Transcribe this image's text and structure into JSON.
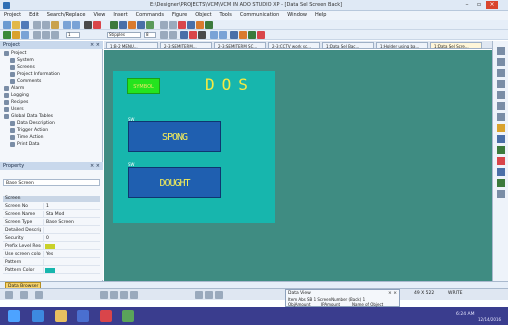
{
  "window": {
    "title": "E:\\Designer\\PROJECTS\\VCM\\VCM IN ADO STUDIO XP - [Data Sel Screen Back]",
    "minimize": "–",
    "restore": "▫",
    "close": "×"
  },
  "menu": {
    "items": [
      "Project",
      "Edit",
      "Search/Replace",
      "View",
      "Insert",
      "Commands",
      "Figure",
      "Object",
      "Tools",
      "Communication",
      "Window",
      "Help"
    ]
  },
  "toolbar": {
    "zoom_value": "1",
    "font_value": "Stipples",
    "size_value": "8"
  },
  "project_panel": {
    "title": "Project",
    "close": "× ×",
    "tree": [
      {
        "label": "Project",
        "indent": 0
      },
      {
        "label": "System",
        "indent": 1
      },
      {
        "label": "Screens",
        "indent": 1
      },
      {
        "label": "Project Information",
        "indent": 1
      },
      {
        "label": "Comments",
        "indent": 1
      },
      {
        "label": "Alarm",
        "indent": 0
      },
      {
        "label": "Logging",
        "indent": 0
      },
      {
        "label": "Recipes",
        "indent": 0
      },
      {
        "label": "Users",
        "indent": 0
      },
      {
        "label": "Global Data Tables",
        "indent": 0
      },
      {
        "label": "Data Description",
        "indent": 1
      },
      {
        "label": "Trigger Action",
        "indent": 1
      },
      {
        "label": "Time Action",
        "indent": 1
      },
      {
        "label": "Print Data",
        "indent": 1
      }
    ],
    "tabs": [
      "Project",
      "System",
      "Screen"
    ]
  },
  "property_panel": {
    "title": "Property",
    "close": "× ×",
    "selected_object": "Base Screen",
    "category": "Screen",
    "rows": [
      {
        "key": "Screen No",
        "value": "1"
      },
      {
        "key": "Screen Name",
        "value": "Sta Mod"
      },
      {
        "key": "Screen Type",
        "value": "Base Screen"
      },
      {
        "key": "Detailed Description",
        "value": ""
      },
      {
        "key": "Security",
        "value": "0"
      },
      {
        "key": "Prefix Level Resource",
        "value": ""
      },
      {
        "key": "Use screen color",
        "value": "Yes"
      },
      {
        "key": "Pattern",
        "value": ""
      },
      {
        "key": "Pattern Color",
        "value": ""
      }
    ],
    "prefix_color": "#c9d12a",
    "pattern_color": "#17b6ad"
  },
  "document_tabs": [
    {
      "label": "1:B-2 MENU...",
      "active": false
    },
    {
      "label": "2-3:SEMITERM...",
      "active": false
    },
    {
      "label": "2-3:SEMITERM SC...",
      "active": false
    },
    {
      "label": "2-3:CCTV work sc...",
      "active": false
    },
    {
      "label": "1:Data Sel Bac...",
      "active": false
    },
    {
      "label": "1:Holder using ba...",
      "active": false
    },
    {
      "label": "1:Data Sel Scre...",
      "active": true
    }
  ],
  "screen": {
    "green_button_label": "SYMBOL",
    "header_text": "DOS",
    "button1_label": "SPONG",
    "button2_label": "DOUGHT",
    "tag1": "SW",
    "tag2": "SW",
    "tag3": "SW"
  },
  "status": {
    "tab_label": "Data Browser"
  },
  "data_view": {
    "title": "Data View",
    "row1": "Item Abs    SB 1 ScreenNumber (Back) 1",
    "cols": [
      "ObjAmount",
      "IPAmount",
      "Name of Object"
    ],
    "close": "× ×"
  },
  "status_right": {
    "coord": "49  X 522",
    "mode": "WRITE"
  },
  "taskbar": {
    "time": "6:24 AM",
    "date": "12/14/2016"
  },
  "colors": {
    "canvas": "#3f8c82",
    "screen": "#17b6ad",
    "green_button": "#24e41e",
    "blue_button": "#1f5fb0",
    "yellow_text": "#f5ea43"
  }
}
